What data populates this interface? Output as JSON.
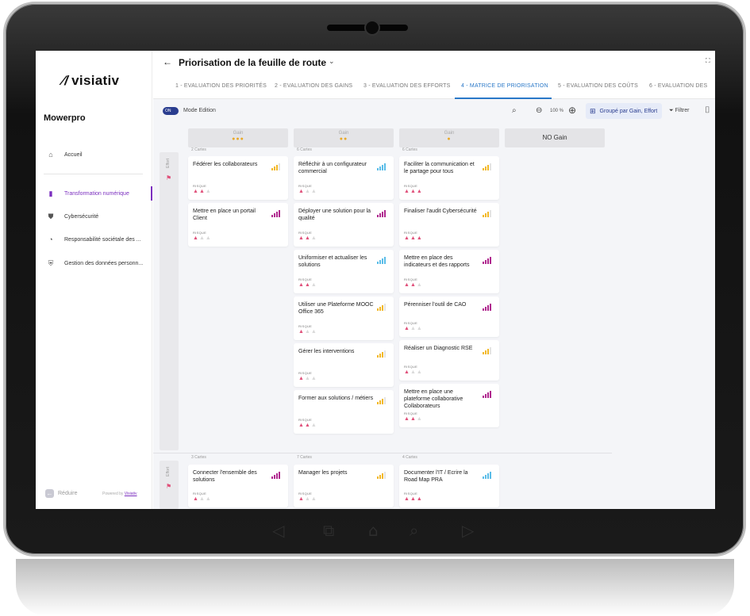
{
  "app": {
    "logo_mark": "⁄/",
    "logo_text": "visiativ",
    "company": "Mowerpro"
  },
  "sidebar": {
    "items": [
      {
        "label": "Accueil",
        "icon": "home-icon"
      },
      {
        "label": "Transformation numérique",
        "icon": "bar-chart-icon",
        "active": true
      },
      {
        "label": "Cybersécurité",
        "icon": "shield-icon"
      },
      {
        "label": "Responsabilité sociétale des ...",
        "icon": "leaf-icon"
      },
      {
        "label": "Gestion des données personn...",
        "icon": "shield-lock-icon"
      }
    ],
    "reduce_label": "Réduire",
    "powered_by": "Powered by",
    "powered_brand": "Visiativ"
  },
  "header": {
    "title": "Priorisation de la feuille de route"
  },
  "tabs": [
    {
      "label": "1 - EVALUATION DES PRIORITÉS"
    },
    {
      "label": "2 - EVALUATION DES GAINS"
    },
    {
      "label": "3 - EVALUATION DES EFFORTS"
    },
    {
      "label": "4 - MATRICE DE PRIORISATION",
      "active": true
    },
    {
      "label": "5 - EVALUATION DES COÛTS"
    },
    {
      "label": "6 - EVALUATION DES"
    }
  ],
  "toolbar": {
    "toggle_label": "ON",
    "mode_label": "Mode Edition",
    "zoom_value": "100 %",
    "group_label": "Groupé par Gain, Effort",
    "filter_label": "Filtrer"
  },
  "columns": [
    {
      "label": "Gain",
      "stars": "●●●"
    },
    {
      "label": "Gain",
      "stars": "●●"
    },
    {
      "label": "Gain",
      "stars": "●"
    },
    {
      "label": "NO Gain",
      "stars": ""
    }
  ],
  "rows": [
    {
      "effort_label": "Effort",
      "counts": [
        "2 Cartes",
        "6 Cartes",
        "6 Cartes"
      ],
      "columns": [
        [
          {
            "title": "Fédérer les collaborateurs",
            "risk_label": "RISQUE",
            "risk": 2,
            "priority": 3,
            "color": "#f2b827"
          },
          {
            "title": "Mettre en place un portail Client",
            "risk_label": "RISQUE",
            "risk": 1,
            "priority": 4,
            "color": "#b0288f"
          }
        ],
        [
          {
            "title": "Réfléchir à un configurateur commercial",
            "risk_label": "RISQUE",
            "risk": 1,
            "priority": 4,
            "color": "#5bbde8"
          },
          {
            "title": "Déployer une solution pour la qualité",
            "risk_label": "RISQUE",
            "risk": 2,
            "priority": 4,
            "color": "#b0288f"
          },
          {
            "title": "Uniformiser et actualiser les solutions",
            "risk_label": "RISQUE",
            "risk": 2,
            "priority": 4,
            "color": "#5bbde8"
          },
          {
            "title": "Utiliser une Plateforme MOOC Office 365",
            "risk_label": "RISQUE",
            "risk": 1,
            "priority": 3,
            "color": "#f2b827"
          },
          {
            "title": "Gérer les interventions",
            "risk_label": "RISQUE",
            "risk": 1,
            "priority": 3,
            "color": "#f2b827"
          },
          {
            "title": "Former aux solutions / métiers",
            "risk_label": "RISQUE",
            "risk": 2,
            "priority": 3,
            "color": "#f2b827"
          }
        ],
        [
          {
            "title": "Faciliter la communication et le partage pour tous",
            "risk_label": "RISQUE",
            "risk": 3,
            "priority": 3,
            "color": "#f2b827"
          },
          {
            "title": "Finaliser l'audit Cybersécurité",
            "risk_label": "RISQUE",
            "risk": 3,
            "priority": 3,
            "color": "#f2b827"
          },
          {
            "title": "Mettre en place des indicateurs et des rapports",
            "risk_label": "RISQUE",
            "risk": 2,
            "priority": 4,
            "color": "#b0288f"
          },
          {
            "title": "Pérenniser l'outil de CAO",
            "risk_label": "RISQUE",
            "risk": 1,
            "priority": 4,
            "color": "#b0288f"
          },
          {
            "title": "Réaliser un Diagnostic RSE",
            "risk_label": "RISQUE",
            "risk": 1,
            "priority": 3,
            "color": "#f2b827"
          },
          {
            "title": "Mettre en place une plateforme collaborative Collaborateurs",
            "risk_label": "RISQUE",
            "risk": 2,
            "priority": 4,
            "color": "#b0288f"
          }
        ]
      ]
    },
    {
      "effort_label": "Effort",
      "counts": [
        "3 Cartes",
        "7 Cartes",
        "4 Cartes"
      ],
      "columns": [
        [
          {
            "title": "Connecter l'ensemble des solutions",
            "risk_label": "RISQUE",
            "risk": 1,
            "priority": 4,
            "color": "#b0288f"
          }
        ],
        [
          {
            "title": "Manager les projets",
            "risk_label": "RISQUE",
            "risk": 1,
            "priority": 3,
            "color": "#f2b827"
          }
        ],
        [
          {
            "title": "Documenter l'IT / Ecrire la Road Map PRA",
            "risk_label": "RISQUE",
            "risk": 3,
            "priority": 4,
            "color": "#5bbde8"
          }
        ]
      ]
    }
  ],
  "nav_keys": [
    "◁",
    "⧉",
    "⌂",
    "⌕",
    "▷"
  ]
}
